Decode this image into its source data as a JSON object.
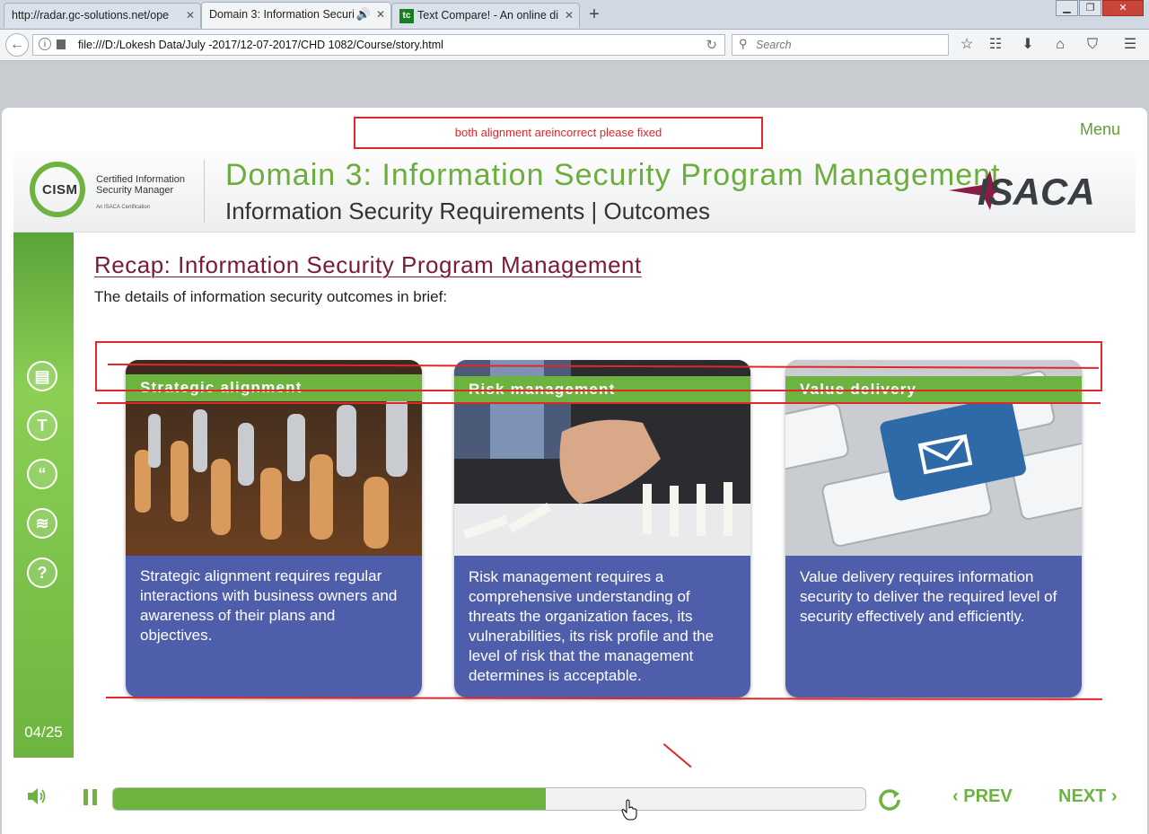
{
  "browser": {
    "tabs": [
      {
        "label": "http://radar.gc-solutions.net/ope"
      },
      {
        "label": "Domain 3: Information Securi"
      },
      {
        "label": "Text Compare! - An online di",
        "favicon": "tc"
      }
    ],
    "url": "file:///D:/Lokesh Data/July -2017/12-07-2017/CHD 1082/Course/story.html",
    "search_placeholder": "Search"
  },
  "player": {
    "menu_label": "Menu",
    "feedback_note": "both alignment areincorrect please fixed",
    "banner": {
      "cism_logo": "CISM",
      "cism_line1": "Certified Information",
      "cism_line2": "Security Manager",
      "cism_line3": "An ISACA Certification",
      "domain_title": "Domain 3: Information Security Program Management",
      "subtitle": "Information Security Requirements | Outcomes",
      "isaca_logo": "ISACA"
    },
    "sidebar": {
      "icons": [
        "notes-icon",
        "text-icon",
        "quote-icon",
        "layers-icon",
        "help-icon"
      ],
      "page_counter": "04/25"
    },
    "content": {
      "title": "Recap: Information Security Program Management",
      "intro": "The details of information security outcomes in brief:",
      "cards": [
        {
          "header": "Strategic alignment",
          "body": "Strategic alignment requires regular interactions with business owners and awareness of their plans and objectives.",
          "image": "chess-pieces"
        },
        {
          "header": "Risk management",
          "body": "Risk management requires a comprehensive understanding of threats the organization faces, its vulnerabilities, its risk profile and the level of risk that the management determines is acceptable.",
          "image": "hand-stopping-dominoes"
        },
        {
          "header": "Value delivery",
          "body": "Value delivery requires information security to deliver the required level of security effectively and efficiently.",
          "image": "keyboard-mail-key"
        }
      ]
    },
    "controls": {
      "progress": 0.575,
      "prev_label": "PREV",
      "next_label": "NEXT"
    },
    "colors": {
      "accent": "#6cb33f",
      "card_body": "#4f5eab",
      "title": "#7a1a3b",
      "annotation": "#e0272b"
    }
  }
}
